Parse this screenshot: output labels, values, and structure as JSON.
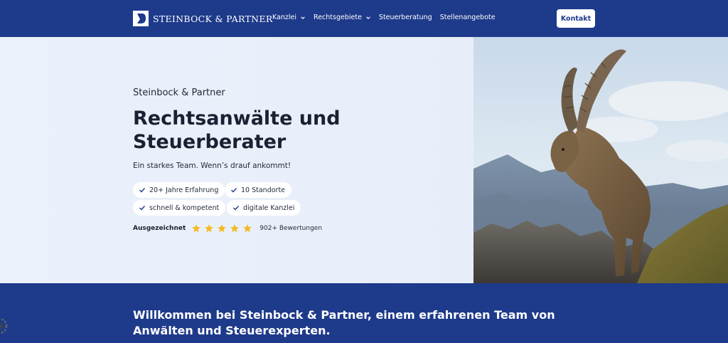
{
  "header": {
    "logo_text": "STEINBOCK & PARTNER",
    "nav": [
      {
        "label": "Kanzlei",
        "dropdown": true
      },
      {
        "label": "Rechtsgebiete",
        "dropdown": true
      },
      {
        "label": "Steuerberatung",
        "dropdown": false
      },
      {
        "label": "Stellenangebote",
        "dropdown": false
      }
    ],
    "contact_label": "Kontakt"
  },
  "hero": {
    "kicker": "Steinbock & Partner",
    "headline": "Rechtsanwälte und Steuerberater",
    "subline": "Ein starkes Team. Wenn’s drauf ankommt!",
    "badges": [
      "20+ Jahre Erfahrung",
      "10 Standorte",
      "schnell & kompetent",
      "digitale Kanzlei"
    ],
    "rating": {
      "label": "Ausgezeichnet",
      "stars": 5,
      "reviews": "902+ Bewertungen"
    }
  },
  "intro": {
    "text": "Willkommen bei Steinbock & Partner, einem erfahrenen Team von Anwälten und Steuerexperten."
  },
  "colors": {
    "brand_blue": "#1e3a8a",
    "hero_bg": "#e9f0fb",
    "star": "#f5b921",
    "check": "#1e3a8a"
  },
  "icons": {
    "logo": "steinbock-logo-icon",
    "chevron": "chevron-down-icon",
    "check": "check-icon",
    "star": "star-icon"
  }
}
